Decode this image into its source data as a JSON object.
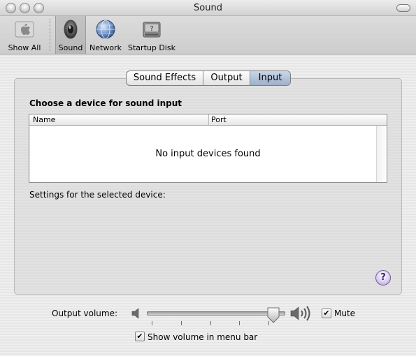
{
  "window": {
    "title": "Sound"
  },
  "toolbar": {
    "items": [
      {
        "label": "Show All",
        "icon": "apple-logo-icon",
        "selected": false
      },
      {
        "label": "Sound",
        "icon": "speaker-icon",
        "selected": true
      },
      {
        "label": "Network",
        "icon": "network-globe-icon",
        "selected": false
      },
      {
        "label": "Startup Disk",
        "icon": "startup-disk-icon",
        "selected": false
      }
    ]
  },
  "tabs": [
    {
      "label": "Sound Effects",
      "active": false
    },
    {
      "label": "Output",
      "active": false
    },
    {
      "label": "Input",
      "active": true
    }
  ],
  "input_pane": {
    "heading": "Choose a device for sound input",
    "table": {
      "columns": [
        "Name",
        "Port"
      ],
      "rows": [],
      "empty_message": "No input devices found"
    },
    "settings_label": "Settings for the selected device:",
    "help": "?"
  },
  "output_volume": {
    "label": "Output volume:",
    "level_fraction": 0.96,
    "tick_count": 5,
    "mute_label": "Mute",
    "mute_checked": true,
    "mute_check_glyph": "✔"
  },
  "menu_bar_option": {
    "label": "Show volume in menu bar",
    "checked": true,
    "check_glyph": "✔"
  },
  "colors": {
    "active_tab": "#a9bad1",
    "help_button": "#d9c8ef"
  }
}
